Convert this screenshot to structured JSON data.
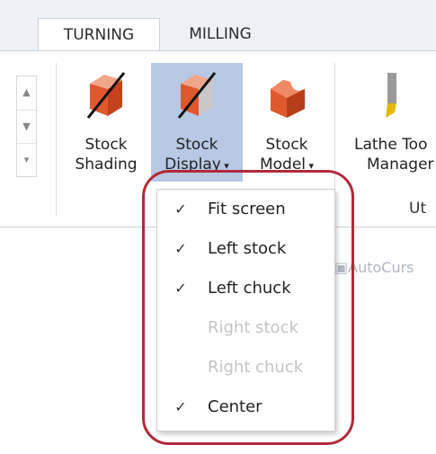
{
  "tabs": {
    "turning": "TURNING",
    "milling": "MILLING"
  },
  "ribbon": {
    "buttons": [
      {
        "line1": "Stock",
        "line2": "Shading"
      },
      {
        "line1": "Stock",
        "line2": "Display"
      },
      {
        "line1": "Stock",
        "line2": "Model"
      },
      {
        "line1": "Lathe Too",
        "line2": "Manager"
      }
    ],
    "group_caption": "Ut",
    "scroll": {
      "up": "▲",
      "down": "▼",
      "more": "▾"
    }
  },
  "toolbar2": {
    "autocursor": "AutoCurs"
  },
  "dropdown": {
    "items": [
      {
        "label": "Fit screen",
        "checked": true,
        "enabled": true,
        "check": "✓"
      },
      {
        "label": "Left stock",
        "checked": true,
        "enabled": true,
        "check": "✓"
      },
      {
        "label": "Left chuck",
        "checked": true,
        "enabled": true,
        "check": "✓"
      },
      {
        "label": "Right stock",
        "checked": false,
        "enabled": false,
        "check": ""
      },
      {
        "label": "Right chuck",
        "checked": false,
        "enabled": false,
        "check": ""
      },
      {
        "label": "Center",
        "checked": true,
        "enabled": true,
        "check": "✓"
      }
    ]
  },
  "colors": {
    "accent_highlight": "#b7c8e4",
    "stock_orange": "#e0582e",
    "annotation_red": "#b22a3a"
  }
}
